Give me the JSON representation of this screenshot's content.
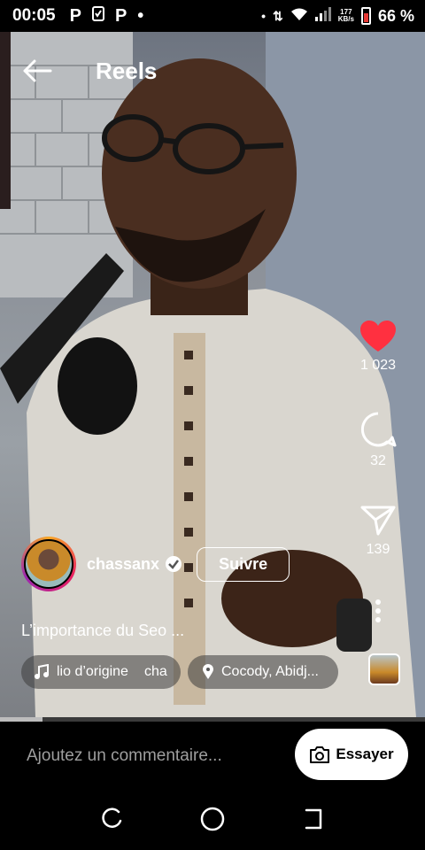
{
  "status_bar": {
    "time": "00:05",
    "speed_value": "177",
    "speed_unit": "KB/s",
    "battery": "66 %"
  },
  "header": {
    "title": "Reels"
  },
  "actions": {
    "likes": "1 023",
    "comments": "32",
    "shares": "139"
  },
  "author": {
    "username": "chassanx",
    "follow_label": "Suivre"
  },
  "caption": "L’importance du Seo ...",
  "chips": {
    "audio_text": "lio d’origine",
    "audio_text_2": "cha",
    "location": "Cocody, Abidj..."
  },
  "progress_fraction": 0.1,
  "comment_bar": {
    "placeholder": "Ajoutez un commentaire...",
    "try_label": "Essayer"
  },
  "colors": {
    "like": "#ff3040",
    "follow_border": "#ffffff"
  },
  "icons": [
    "back-arrow-icon",
    "heart-icon",
    "comment-bubble-icon",
    "send-icon",
    "more-vert-icon",
    "music-note-icon",
    "location-pin-icon",
    "camera-icon",
    "verified-badge-icon"
  ]
}
